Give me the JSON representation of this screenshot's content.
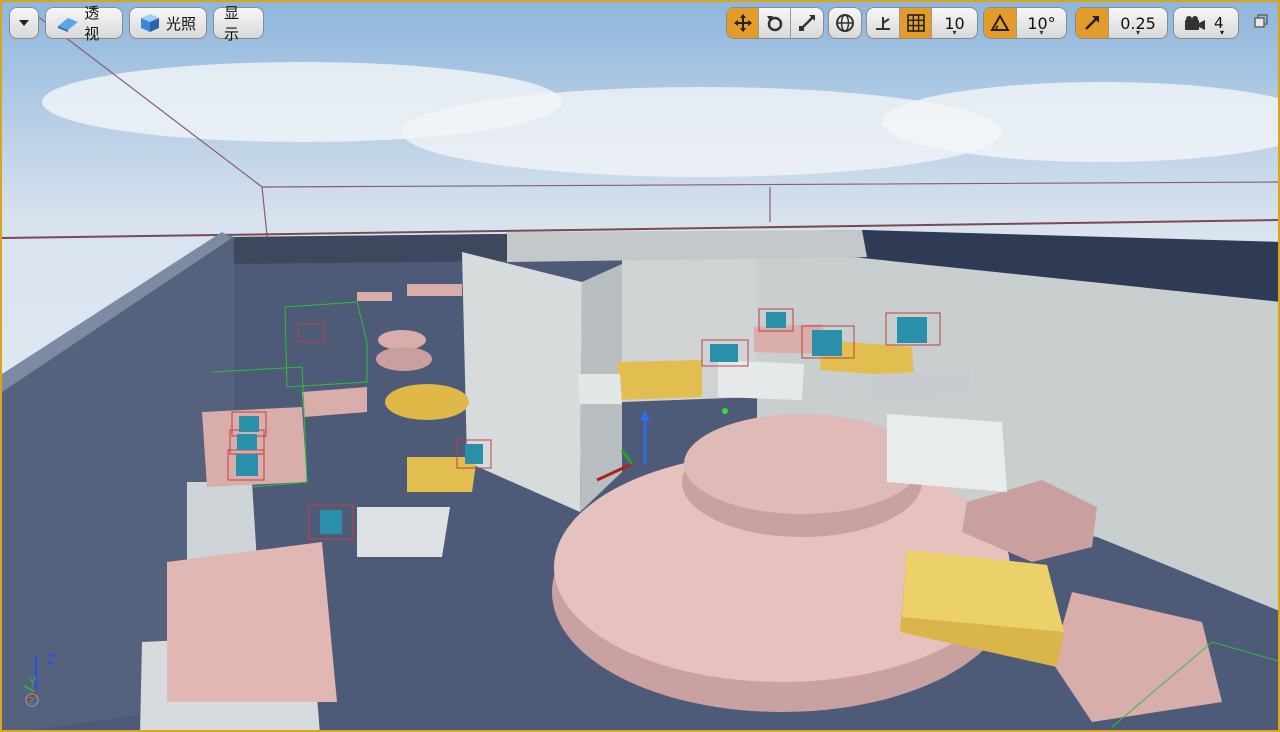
{
  "toolbar": {
    "menu_icon": "chevron-down-icon",
    "perspective_label": "透视",
    "lit_label": "光照",
    "show_label": "显示",
    "grid_snap_value": "10",
    "rotation_snap_value": "10°",
    "scale_snap_value": "0.25",
    "camera_speed_value": "4"
  },
  "axis_gizmo": {
    "z": "Z",
    "y": "Y"
  },
  "colors": {
    "accent": "#e39b2a",
    "viewport_border": "#d9a51f"
  }
}
